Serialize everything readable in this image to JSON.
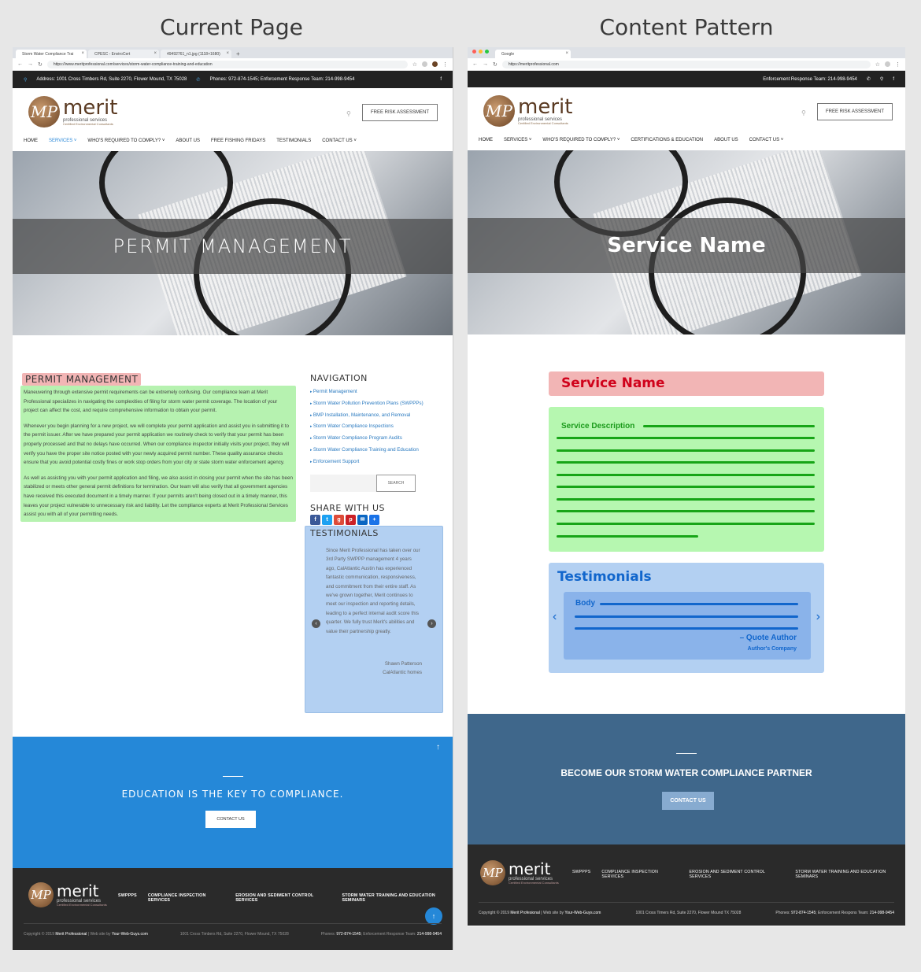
{
  "headings": {
    "left": "Current Page",
    "right": "Content Pattern"
  },
  "current": {
    "tabs": [
      "Storm Water Compliance Trai",
      "CPESC - EnviroCert",
      "49492761_n1.jpg (1118×1680)"
    ],
    "url": "https://www.meritprofessional.com/services/storm-water-compliance-training-and-education",
    "address": "Address: 1001 Cross Timbers Rd, Suite 2270, Flower Mound, TX 75028",
    "phones": "Phones: 972-874-1545; Enforcement Response Team: 214-998-9454",
    "logo": {
      "word": "merit",
      "sub": "professional services",
      "tag": "Certified Environmental Consultants",
      "mark": "MP"
    },
    "risk_button": "FREE RISK ASSESSMENT",
    "nav": [
      "HOME",
      "SERVICES ˅",
      "WHO'S REQUIRED TO COMPLY? ˅",
      "ABOUT US",
      "FREE FISHING FRIDAYS",
      "TESTIMONIALS",
      "CONTACT US ˅"
    ],
    "hero_title": "PERMIT MANAGEMENT",
    "page_title": "PERMIT MANAGEMENT",
    "paragraphs": [
      "Maneuvering through extensive permit requirements can be extremely confusing. Our compliance team at Merit Professional specializes in navigating the complexities of filing for storm water permit coverage. The location of your project can affect the cost, and require comprehensive information to obtain your permit.",
      "Whenever you begin planning for a new project, we will complete your permit application and assist you in submitting it to the permit issuer. After we have prepared your permit application we routinely check to verify that your permit has been properly processed and that no delays have occurred. When our compliance inspector initially visits your project, they will verify you have the proper site notice posted with your newly acquired permit number. These quality assurance checks ensure that you avoid potential costly fines or work stop orders from your city or state storm water enforcement agency.",
      "As well as assisting you with your permit application and filing, we also assist in closing your permit when the site has been stabilized or meets other general permit definitions for termination. Our team will also verify that all government agencies have received this executed document in a timely manner. If your permits aren't being closed out in a timely manner, this leaves your project vulnerable to unnecessary risk and liability. Let the compliance experts at Merit Professional Services assist you with all of your permitting needs."
    ],
    "sidebar": {
      "nav_title": "NAVIGATION",
      "links": [
        "Permit Management",
        "Storm Water Pollution Prevention Plans (SWPPPs)",
        "BMP Installation, Maintenance, and Removal",
        "Storm Water Compliance Inspections",
        "Storm Water Compliance Program Audits",
        "Storm Water Compliance Training and Education",
        "Enforcement Support"
      ],
      "search_button": "SEARCH",
      "share_title": "SHARE WITH US",
      "testimonials_title": "TESTIMONIALS",
      "quote": "Since Merit Professional has taken over our 3rd Party SWPPP management 4 years ago, CalAtlantic Austin has experienced fantastic communication, responsiveness, and commitment from their entire staff. As we've grown together, Merit continues to meet our inspection and reporting details, leading to a perfect internal audit score this quarter. We fully trust Merit's abilities and value their partnership greatly.",
      "author": "Shawn Patterson",
      "company": "CalAtlantic homes"
    },
    "cta": {
      "title": "EDUCATION IS THE KEY TO COMPLIANCE.",
      "button": "CONTACT US"
    },
    "footer": {
      "links": [
        "SWPPPS",
        "COMPLIANCE INSPECTION SERVICES",
        "EROSION AND SEDIMENT CONTROL SERVICES",
        "STORM WATER TRAINING AND EDUCATION SEMINARS"
      ],
      "copyright": "Copyright © 2019",
      "brand": "Merit Professional",
      "site_by": "| Web site by",
      "site_by_name": "Your-Web-Guys.com",
      "address": "1001 Cross Timbers Rd, Suite 2270, Flower Mound, TX 75028",
      "phones_label": "Phones:",
      "phone": "972-874-1545",
      "ert_label": "; Enforcement Response Team:",
      "ert": "214-998-9454"
    }
  },
  "pattern": {
    "tab": "Google",
    "url": "https://meritprofessional.com",
    "ert": "Enforcement Response Team: 214-998-9454",
    "risk_button": "FREE RISK ASSESSMENT",
    "nav": [
      "HOME",
      "SERVICES ˅",
      "WHO'S REQUIRED TO COMPLY? ˅",
      "CERTIFICATIONS & EDUCATION",
      "ABOUT US",
      "CONTACT US ˅"
    ],
    "hero_title": "Service Name",
    "service_name": "Service Name",
    "service_description": "Service Description",
    "testimonials_title": "Testimonials",
    "body_label": "Body",
    "quote_author": "– Quote Author",
    "author_company": "Author's Company",
    "cta": {
      "title": "BECOME OUR STORM WATER COMPLIANCE PARTNER",
      "button": "CONTACT US"
    },
    "footer": {
      "links": [
        "SWPPPS",
        "COMPLIANCE INSPECTION SERVICES",
        "EROSION AND SEDIMENT CONTROL SERVICES",
        "STORM WATER TRAINING AND EDUCATION SEMINARS"
      ],
      "copyright": "Copyright © 2019",
      "brand": "Merit Profesional",
      "site_by": "| Web site by",
      "site_by_name": "Your-Web-Guys.com",
      "address": "1001 Cross Timers Rd, Suite 2270, Flower Mound TX 75028",
      "phones_label": "Phones:",
      "phone": "972-874-1545",
      "ert_label": "; Enforcement Respons Team:",
      "ert": "214-998-9454"
    }
  },
  "colors": {
    "service_name_bg": "#f2b5b5",
    "description_bg": "#b6f7b0",
    "testimonials_bg": "#b3d0f2",
    "cta_left": "#2588d8",
    "cta_right": "#3f678b"
  }
}
